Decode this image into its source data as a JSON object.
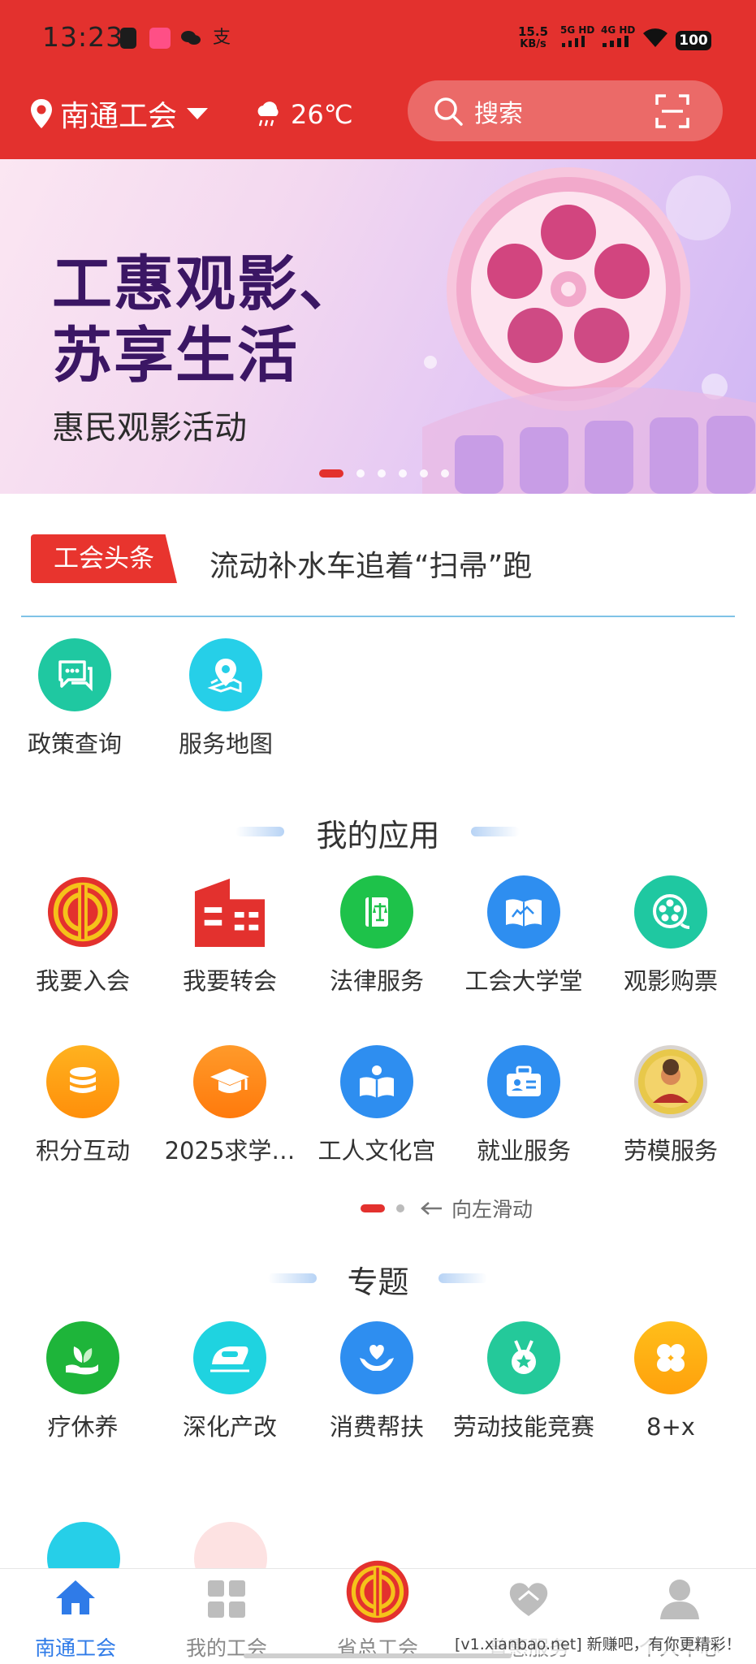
{
  "status_bar": {
    "time": "13:23",
    "net_speed_value": "15.5",
    "net_speed_unit": "KB/s",
    "signal1": "5G HD",
    "signal2": "4G HD",
    "battery": "100"
  },
  "header": {
    "location": "南通工会",
    "temperature": "26℃",
    "search_placeholder": "搜索"
  },
  "banner": {
    "headline_line1": "工惠观影、",
    "headline_line2": "苏享生活",
    "subtitle": "惠民观影活动",
    "slide_count": 6,
    "active_slide": 1
  },
  "headline": {
    "tag": "工会头条",
    "text": "流动补水车追着“扫帚”跑"
  },
  "quick_links": [
    {
      "label": "政策查询",
      "icon": "policy-chat-icon",
      "color": "#1fc8a1"
    },
    {
      "label": "服务地图",
      "icon": "map-pin-icon",
      "color": "#26cfe8"
    }
  ],
  "my_apps": {
    "title": "我的应用",
    "row1": [
      {
        "label": "我要入会",
        "icon": "union-emblem-icon"
      },
      {
        "label": "我要转会",
        "icon": "building-icon"
      },
      {
        "label": "法律服务",
        "icon": "law-book-icon"
      },
      {
        "label": "工会大学堂",
        "icon": "open-book-icon"
      },
      {
        "label": "观影购票",
        "icon": "film-reel-icon"
      }
    ],
    "row2": [
      {
        "label": "积分互动",
        "icon": "coins-icon"
      },
      {
        "label": "2025求学…",
        "icon": "graduation-cap-icon"
      },
      {
        "label": "工人文化宫",
        "icon": "reading-icon"
      },
      {
        "label": "就业服务",
        "icon": "briefcase-icon"
      },
      {
        "label": "劳模服务",
        "icon": "model-worker-badge-icon"
      }
    ],
    "swipe_hint": "向左滑动"
  },
  "topics": {
    "title": "专题",
    "row1": [
      {
        "label": "疗休养",
        "icon": "leaf-hand-icon"
      },
      {
        "label": "深化产改",
        "icon": "train-icon"
      },
      {
        "label": "消费帮扶",
        "icon": "heart-hands-icon"
      },
      {
        "label": "劳动技能竞赛",
        "icon": "medal-icon"
      },
      {
        "label": "8+x",
        "icon": "clover-icon"
      }
    ]
  },
  "tabbar": [
    {
      "label": "南通工会",
      "icon": "home-icon"
    },
    {
      "label": "我的工会",
      "icon": "grid-icon"
    },
    {
      "label": "省总工会",
      "icon": "union-emblem-icon"
    },
    {
      "label": "普惠服务",
      "icon": "heart-icon"
    },
    {
      "label": "个人中心",
      "icon": "person-icon"
    }
  ],
  "watermark": "[v1.xianbao.net] 新赚吧，有你更精彩！",
  "colors": {
    "brand_red": "#e3312e",
    "active_blue": "#2f7be8"
  }
}
